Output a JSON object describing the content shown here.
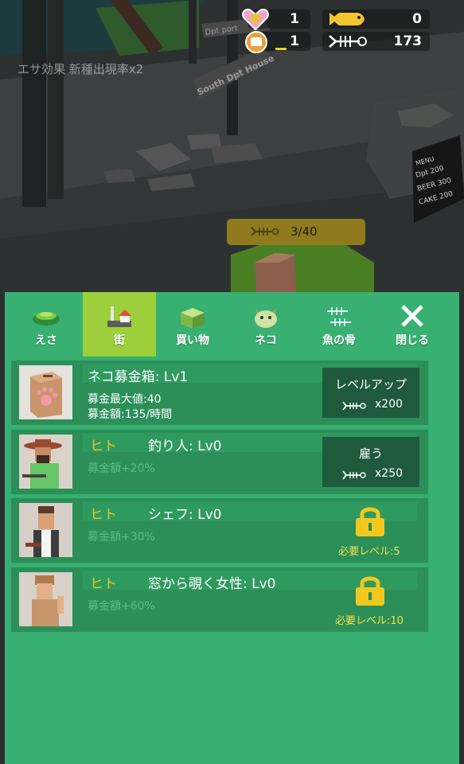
{
  "hud": {
    "hearts": "1",
    "level": "1",
    "fish": "0",
    "bones": "173"
  },
  "scene": {
    "buff_text": "エサ効果 新種出現率x2",
    "sign_top": "Dpt port",
    "sign_bottom": "South Dpt House",
    "progress": "3/40",
    "menu_board": [
      "MENU",
      "Dpt 200",
      "BEER 300",
      "CAKE 200"
    ]
  },
  "tabs": [
    {
      "label": "えさ",
      "icon": "food-bowl-icon"
    },
    {
      "label": "街",
      "icon": "town-icon",
      "active": true
    },
    {
      "label": "買い物",
      "icon": "shopping-box-icon"
    },
    {
      "label": "ネコ",
      "icon": "cat-face-icon"
    },
    {
      "label": "魚の骨",
      "icon": "fish-bones-icon"
    },
    {
      "label": "閉じる",
      "icon": "close-icon"
    }
  ],
  "rows": [
    {
      "title": "ネコ募金箱: Lv1",
      "stat1": "募金最大値:40",
      "stat2": "募金額:135/時間",
      "button_label": "レベルアップ",
      "cost": "x200"
    },
    {
      "kind": "ヒト",
      "title": "釣り人: Lv0",
      "stat1": "募金額+20%",
      "button_label": "雇う",
      "cost": "x250"
    },
    {
      "kind": "ヒト",
      "title": "シェフ: Lv0",
      "stat1": "募金額+30%",
      "requirement": "必要レベル:5"
    },
    {
      "kind": "ヒト",
      "title": "窓から覗く女性: Lv0",
      "stat1": "募金額+60%",
      "requirement": "必要レベル:10"
    }
  ],
  "colors": {
    "panel": "#37b071",
    "active_tab": "#9ccf3b",
    "row": "#2c8f58",
    "button": "#1f5a3c",
    "accent_yellow": "#e9c62a"
  }
}
